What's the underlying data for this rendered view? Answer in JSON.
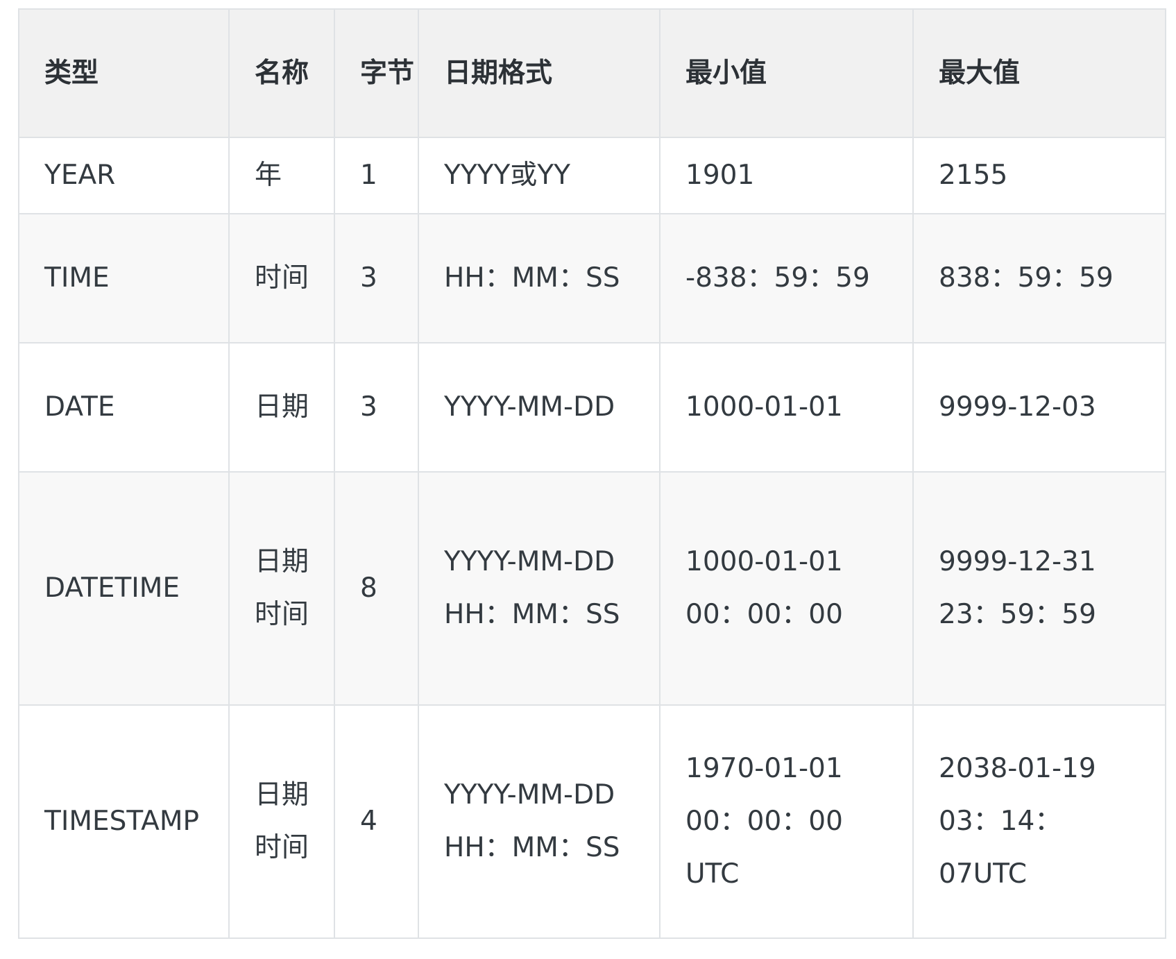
{
  "table": {
    "headers": [
      "类型",
      "名称",
      "字节",
      "日期格式",
      "最小值",
      "最大值"
    ],
    "rows": [
      {
        "type": "YEAR",
        "name": "年",
        "bytes": "1",
        "format": [
          "YYYY或YY"
        ],
        "min": [
          "1901"
        ],
        "max": [
          "2155"
        ]
      },
      {
        "type": "TIME",
        "name": "时间",
        "bytes": "3",
        "format": [
          "HH：MM：SS"
        ],
        "min": [
          "-838：59：59"
        ],
        "max": [
          "838：59：59"
        ]
      },
      {
        "type": "DATE",
        "name": "日期",
        "bytes": "3",
        "format": [
          "YYYY-MM-DD"
        ],
        "min": [
          "1000-01-01"
        ],
        "max": [
          "9999-12-03"
        ]
      },
      {
        "type": "DATETIME",
        "name": "日期时间",
        "bytes": "8",
        "format": [
          "YYYY-MM-DD",
          "HH：MM：SS"
        ],
        "min": [
          "1000-01-01",
          "00：00：00"
        ],
        "max": [
          "9999-12-31",
          "23：59：59"
        ]
      },
      {
        "type": "TIMESTAMP",
        "name": "日期时间",
        "bytes": "4",
        "format": [
          "YYYY-MM-DD",
          "HH：MM：SS"
        ],
        "min": [
          "1970-01-01",
          "00：00：00",
          "UTC"
        ],
        "max": [
          "2038-01-19",
          "03：14：",
          "07UTC"
        ]
      }
    ]
  }
}
